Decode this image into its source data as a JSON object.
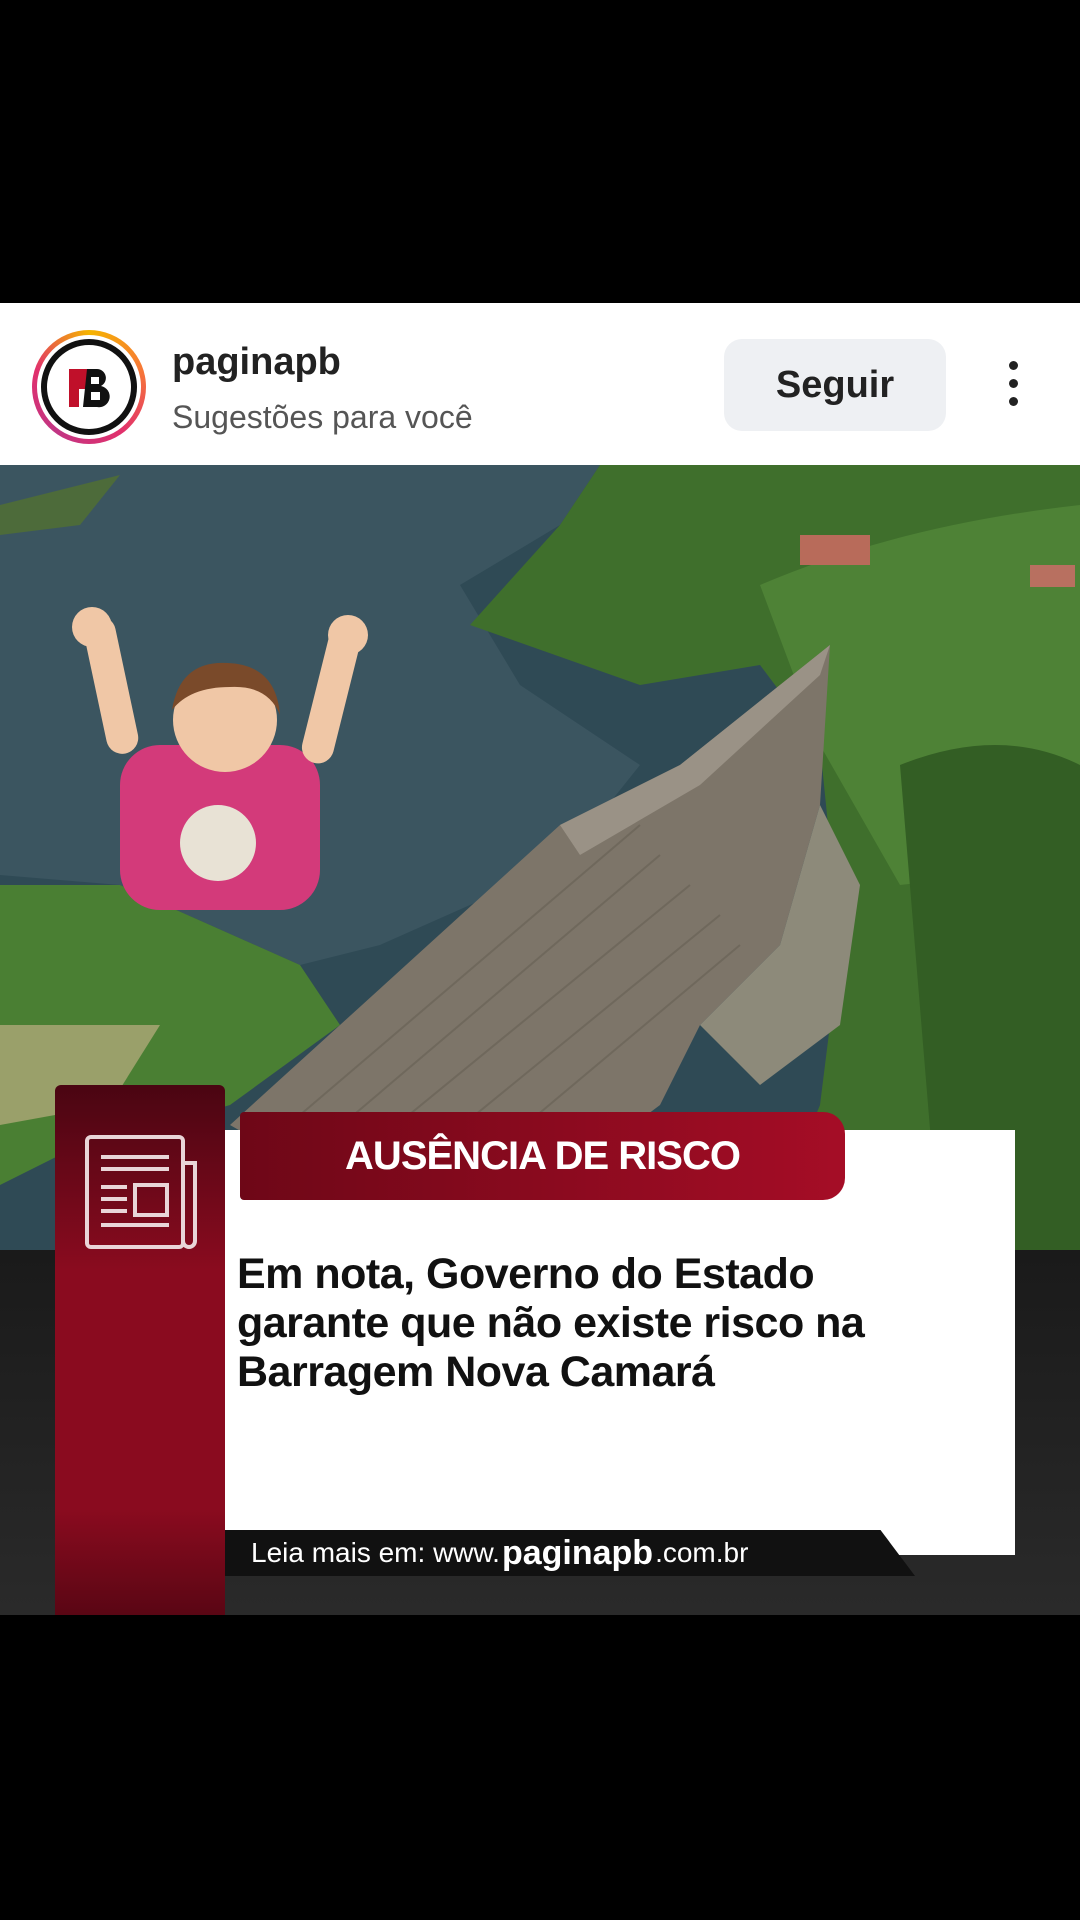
{
  "header": {
    "username": "paginapb",
    "subtitle": "Sugestões para você",
    "follow_label": "Seguir",
    "avatar_icon": "paginapb-logo-icon"
  },
  "post": {
    "badge": "AUSÊNCIA DE RISCO",
    "headline": "Em nota, Governo do Estado garante que não existe risco na Barragem Nova Camará",
    "readmore_prefix": "Leia mais em: www.",
    "readmore_brand": "paginapb",
    "readmore_suffix": ".com.br",
    "sidebar_icon": "newspaper-icon"
  },
  "colors": {
    "brand_red": "#8a0b1f",
    "badge_red": "#a50d26",
    "follow_bg": "#eef0f3"
  }
}
